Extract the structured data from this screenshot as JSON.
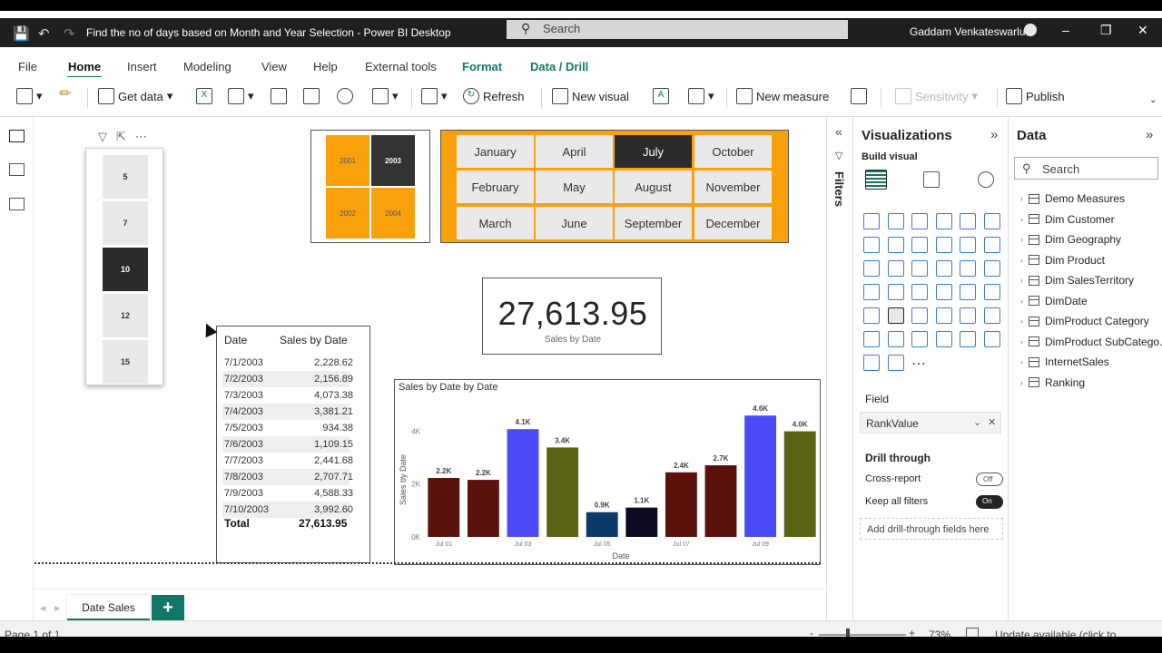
{
  "window": {
    "title": "Find the no of days based on Month and Year Selection - Power BI Desktop",
    "search_placeholder": "Search",
    "user": "Gaddam Venkateswarlu"
  },
  "menu": {
    "items": [
      "File",
      "Home",
      "Insert",
      "Modeling",
      "View",
      "Help",
      "External tools",
      "Format",
      "Data / Drill"
    ],
    "active": "Home"
  },
  "ribbon": {
    "get_data": "Get data",
    "refresh": "Refresh",
    "new_visual": "New visual",
    "new_measure": "New measure",
    "sensitivity": "Sensitivity",
    "publish": "Publish"
  },
  "slicer_numbers": {
    "items": [
      "5",
      "7",
      "10",
      "12",
      "15"
    ],
    "selected": "10"
  },
  "slicer_years": {
    "items": [
      "2001",
      "2003",
      "2002",
      "2004"
    ],
    "selected": "2003"
  },
  "slicer_months": {
    "items": [
      "January",
      "April",
      "July",
      "October",
      "February",
      "May",
      "August",
      "November",
      "March",
      "June",
      "September",
      "December"
    ],
    "selected": "July"
  },
  "card": {
    "value": "27,613.95",
    "label": "Sales by Date"
  },
  "table": {
    "headers": [
      "Date",
      "Sales by Date"
    ],
    "rows": [
      {
        "date": "7/1/2003",
        "sales": "2,228.62"
      },
      {
        "date": "7/2/2003",
        "sales": "2,156.89"
      },
      {
        "date": "7/3/2003",
        "sales": "4,073.38"
      },
      {
        "date": "7/4/2003",
        "sales": "3,381.21"
      },
      {
        "date": "7/5/2003",
        "sales": "934.38"
      },
      {
        "date": "7/6/2003",
        "sales": "1,109.15"
      },
      {
        "date": "7/7/2003",
        "sales": "2,441.68"
      },
      {
        "date": "7/8/2003",
        "sales": "2,707.71"
      },
      {
        "date": "7/9/2003",
        "sales": "4,588.33"
      },
      {
        "date": "7/10/2003",
        "sales": "3,992.60"
      }
    ],
    "total_label": "Total",
    "total_value": "27,613.95"
  },
  "chart_data": {
    "type": "bar",
    "title": "Sales by Date by Date",
    "xlabel": "Date",
    "ylabel": "Sales by Date",
    "categories": [
      "Jul 01",
      "Jul 02",
      "Jul 03",
      "Jul 04",
      "Jul 05",
      "Jul 06",
      "Jul 07",
      "Jul 08",
      "Jul 09",
      "Jul 10"
    ],
    "x_tick_labels": [
      "Jul 01",
      "",
      "Jul 03",
      "",
      "Jul 05",
      "",
      "Jul 07",
      "",
      "Jul 09",
      ""
    ],
    "values": [
      2228.62,
      2156.89,
      4073.38,
      3381.21,
      934.38,
      1109.15,
      2441.68,
      2707.71,
      4588.33,
      3992.6
    ],
    "data_labels": [
      "2.2K",
      "2.2K",
      "4.1K",
      "3.4K",
      "0.9K",
      "1.1K",
      "2.4K",
      "2.7K",
      "4.6K",
      "4.0K"
    ],
    "colors": [
      "#5c120c",
      "#5c120c",
      "#4b4bf7",
      "#5b6313",
      "#0b3a6b",
      "#0f0b24",
      "#5c120c",
      "#5c120c",
      "#4b4bf7",
      "#5b6313"
    ],
    "yticks": [
      "0K",
      "2K",
      "4K"
    ],
    "ylim": [
      0,
      4800
    ],
    "grid": false
  },
  "tabs": {
    "page": "Date Sales",
    "add": "+"
  },
  "filters": {
    "label": "Filters"
  },
  "visualizations": {
    "title": "Visualizations",
    "build_visual": "Build visual",
    "field_label": "Field",
    "field_value": "RankValue",
    "drill_through": "Drill through",
    "cross_report": "Cross-report",
    "cross_report_state": "Off",
    "keep_filters": "Keep all filters",
    "keep_filters_state": "On",
    "add_fields": "Add drill-through fields here"
  },
  "data_pane": {
    "title": "Data",
    "search_placeholder": "Search",
    "tables": [
      "Demo Measures",
      "Dim Customer",
      "Dim Geography",
      "Dim Product",
      "Dim SalesTerritory",
      "DimDate",
      "DimProduct Category",
      "DimProduct SubCatego...",
      "InternetSales",
      "Ranking"
    ]
  },
  "status": {
    "page": "Page 1 of 1",
    "zoom": "73%",
    "update": "Update available (click to download)"
  }
}
